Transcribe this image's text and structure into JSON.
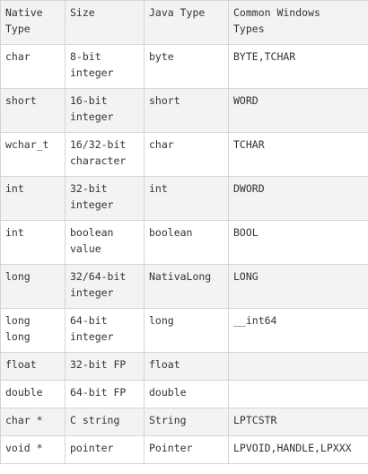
{
  "table": {
    "headers": [
      "Native\nType",
      "Size",
      "Java Type",
      "Common Windows\nTypes"
    ],
    "rows": [
      [
        "char",
        "8-bit\ninteger",
        "byte",
        "BYTE,TCHAR"
      ],
      [
        "short",
        "16-bit\ninteger",
        "short",
        "WORD"
      ],
      [
        "wchar_t",
        "16/32-bit\ncharacter",
        "char",
        "TCHAR"
      ],
      [
        "int",
        "32-bit\ninteger",
        "int",
        "DWORD"
      ],
      [
        "int",
        "boolean\nvalue",
        "boolean",
        "BOOL"
      ],
      [
        "long",
        "32/64-bit\ninteger",
        "NativaLong",
        "LONG"
      ],
      [
        "long\nlong",
        "64-bit\ninteger",
        "long",
        "__int64"
      ],
      [
        "float",
        "32-bit FP",
        "float",
        ""
      ],
      [
        "double",
        "64-bit FP",
        "double",
        ""
      ],
      [
        "char *",
        "C string",
        "String",
        "LPTCSTR"
      ],
      [
        "void *",
        "pointer",
        "Pointer",
        "LPVOID,HANDLE,LPXXX"
      ]
    ]
  }
}
